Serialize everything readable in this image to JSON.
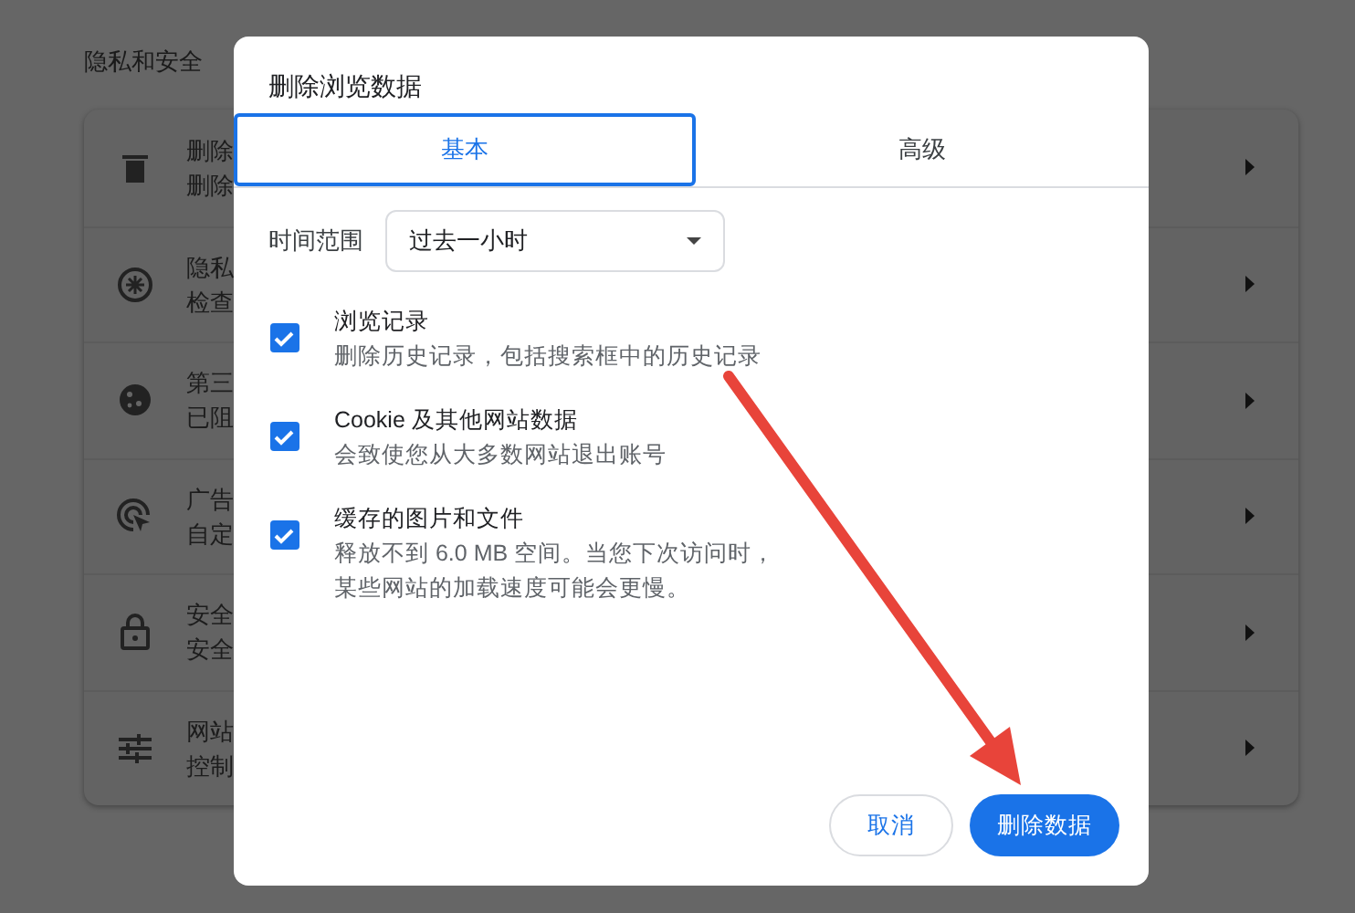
{
  "section_title": "隐私和安全",
  "settings_rows": [
    {
      "kind": "trash",
      "title": "删除",
      "subtitle": "删除"
    },
    {
      "kind": "guide",
      "title": "隐私",
      "subtitle": "检查"
    },
    {
      "kind": "cookie",
      "title": "第三",
      "subtitle": "已阻"
    },
    {
      "kind": "ads",
      "title": "广告",
      "subtitle": "自定"
    },
    {
      "kind": "lock",
      "title": "安全",
      "subtitle": "安全"
    },
    {
      "kind": "sliders",
      "title": "网站",
      "subtitle": "控制"
    }
  ],
  "dialog": {
    "title": "删除浏览数据",
    "tabs": [
      {
        "label": "基本",
        "selected": true
      },
      {
        "label": "高级",
        "selected": false
      }
    ],
    "time_range": {
      "label": "时间范围",
      "value": "过去一小时"
    },
    "options": [
      {
        "title": "浏览记录",
        "description": "删除历史记录，包括搜索框中的历史记录",
        "checked": true
      },
      {
        "title": "Cookie 及其他网站数据",
        "description": "会致使您从大多数网站退出账号",
        "checked": true
      },
      {
        "title": "缓存的图片和文件",
        "description": "释放不到 6.0 MB 空间。当您下次访问时，某些网站的加载速度可能会更慢。",
        "checked": true
      }
    ],
    "buttons": [
      {
        "kind": "secondary",
        "label": "取消"
      },
      {
        "kind": "primary",
        "label": "删除数据"
      }
    ]
  }
}
